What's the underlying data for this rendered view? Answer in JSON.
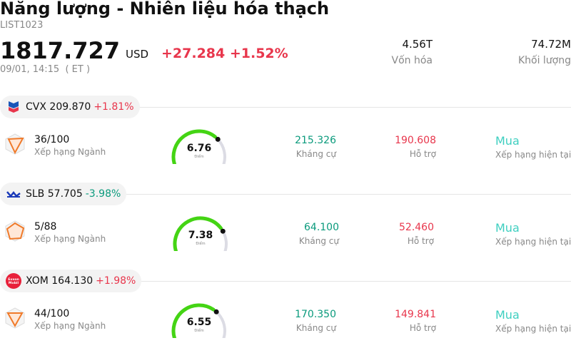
{
  "header": {
    "title": "Năng lượng - Nhiên liệu hóa thạch",
    "code": "LIST1023",
    "price": "1817.727",
    "currency": "USD",
    "change": "+27.284 +1.52%",
    "time": "09/01, 14:15  ( ET )"
  },
  "stats": [
    {
      "value": "4.56T",
      "label": "Vốn hóa"
    },
    {
      "value": "74.72M",
      "label": "Khối lượng"
    }
  ],
  "stocks": [
    {
      "ticker": "CVX",
      "price": "209.870",
      "change": "+1.81%",
      "direction": "up",
      "logo": "chevron-logo",
      "rank": "36/100",
      "rank_label": "Xếp hạng Ngành",
      "score": "6.76",
      "score_label": "Điểm",
      "score_fraction": 0.676,
      "resistance": "215.326",
      "resistance_label": "Kháng cự",
      "support": "190.608",
      "support_label": "Hỗ trợ",
      "rating": "Mua",
      "rating_label": "Xếp hạng hiện tại"
    },
    {
      "ticker": "SLB",
      "price": "57.705",
      "change": "-3.98%",
      "direction": "down",
      "logo": "slb-logo",
      "rank": "5/88",
      "rank_label": "Xếp hạng Ngành",
      "score": "7.38",
      "score_label": "Điểm",
      "score_fraction": 0.738,
      "resistance": "64.100",
      "resistance_label": "Kháng cự",
      "support": "52.460",
      "support_label": "Hỗ trợ",
      "rating": "Mua",
      "rating_label": "Xếp hạng hiện tại"
    },
    {
      "ticker": "XOM",
      "price": "164.130",
      "change": "+1.98%",
      "direction": "up",
      "logo": "exxonmobil-logo",
      "logo_text": "Exxon Mobil",
      "rank": "44/100",
      "rank_label": "Xếp hạng Ngành",
      "score": "6.55",
      "score_label": "Điểm",
      "score_fraction": 0.655,
      "resistance": "170.350",
      "resistance_label": "Kháng cự",
      "support": "149.841",
      "support_label": "Hỗ trợ",
      "rating": "Mua",
      "rating_label": "Xếp hạng hiện tại"
    }
  ],
  "colors": {
    "up": "#e8364c",
    "down": "#0a9a7c",
    "gauge_fill": "#44d414",
    "gauge_track": "#dcdce4",
    "rating": "#3ecfc0",
    "rank_icon": "#f07a2a"
  }
}
